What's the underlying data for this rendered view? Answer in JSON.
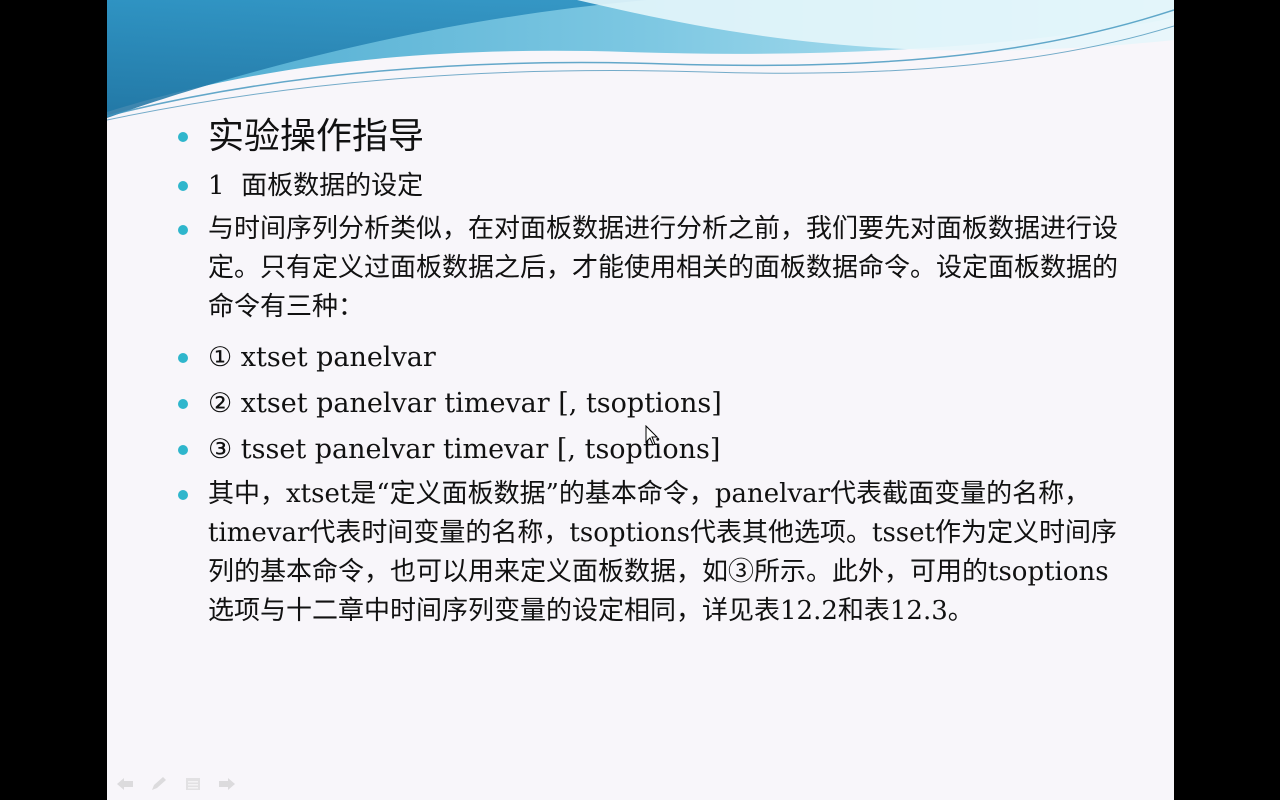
{
  "slide": {
    "title": "实验操作指导",
    "subtitle": "1  面板数据的设定",
    "intro": "与时间序列分析类似，在对面板数据进行分析之前，我们要先对面板数据进行设定。只有定义过面板数据之后，才能使用相关的面板数据命令。设定面板数据的命令有三种：",
    "commands": [
      "① xtset panelvar",
      "② xtset panelvar timevar [, tsoptions]",
      "③ tsset panelvar timevar [, tsoptions]"
    ],
    "explanation": "其中，xtset是“定义面板数据”的基本命令，panelvar代表截面变量的名称，timevar代表时间变量的名称，tsoptions代表其他选项。tsset作为定义时间序列的基本命令，也可以用来定义面板数据，如③所示。此外，可用的tsoptions选项与十二章中时间序列变量的设定相同，详见表12.2和表12.3。"
  },
  "colors": {
    "bullet": "#2fb6cc",
    "wave_dark": "#1d8fb8",
    "wave_light": "#b9e4f2",
    "slide_bg": "#f8f6fa"
  },
  "icons": [
    "back-arrow-icon",
    "pen-icon",
    "menu-icon",
    "forward-arrow-icon"
  ]
}
